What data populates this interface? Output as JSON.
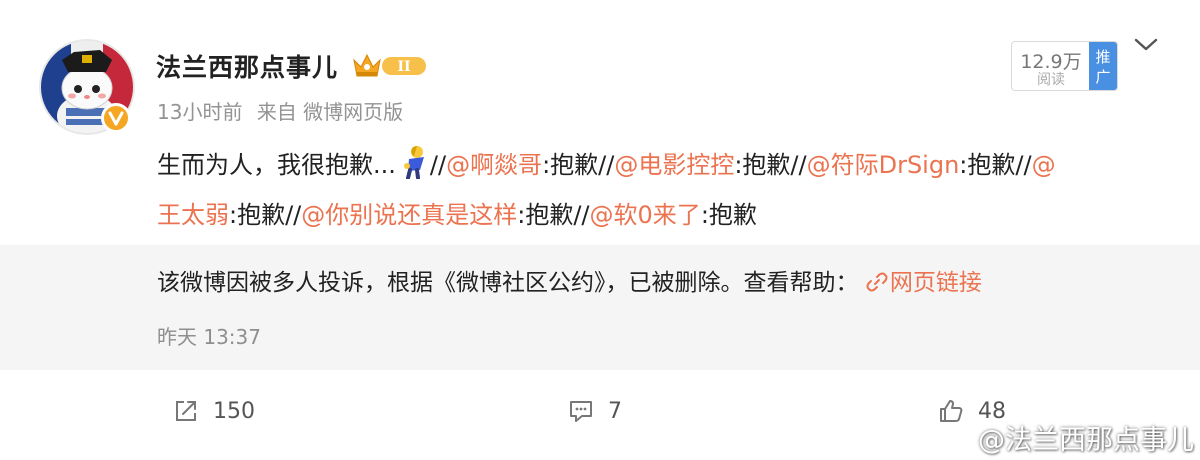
{
  "post": {
    "author": "法兰西那点事儿",
    "time": "13小时前",
    "source": "来自 微博网页版",
    "read_count": "12.9万",
    "read_label": "阅读",
    "promote_label_1": "推",
    "promote_label_2": "广",
    "text": {
      "t1": "生而为人，我很抱歉...",
      "t2": "//",
      "m1": "@啊燚哥",
      "t3": ":抱歉//",
      "m2": "@电影控控",
      "t4": ":抱歉//",
      "m3": "@符际DrSign",
      "t5": ":抱歉//",
      "m4a": "@",
      "m4b": "王太弱",
      "t6": ":抱歉//",
      "m5": "@你别说还真是这样",
      "t7": ":抱歉//",
      "m6": "@软0来了",
      "t8": ":抱歉"
    },
    "icons": {
      "emoji": "bowing-person-emoji",
      "badge": "verified-v-icon",
      "crown": "crown-level-2-icon",
      "chevron": "chevron-down-icon"
    }
  },
  "retweet": {
    "notice": "该微博因被多人投诉，根据《微博社区公约》，已被删除。查看帮助：",
    "link": "网页链接",
    "time": "昨天 13:37"
  },
  "actions": {
    "repost_count": "150",
    "comment_count": "7",
    "like_count": "48"
  },
  "watermark": "@法兰西那点事儿",
  "colors": {
    "mention": "#eb7350",
    "badge": "#f5a623",
    "promote": "#4a90e2"
  }
}
